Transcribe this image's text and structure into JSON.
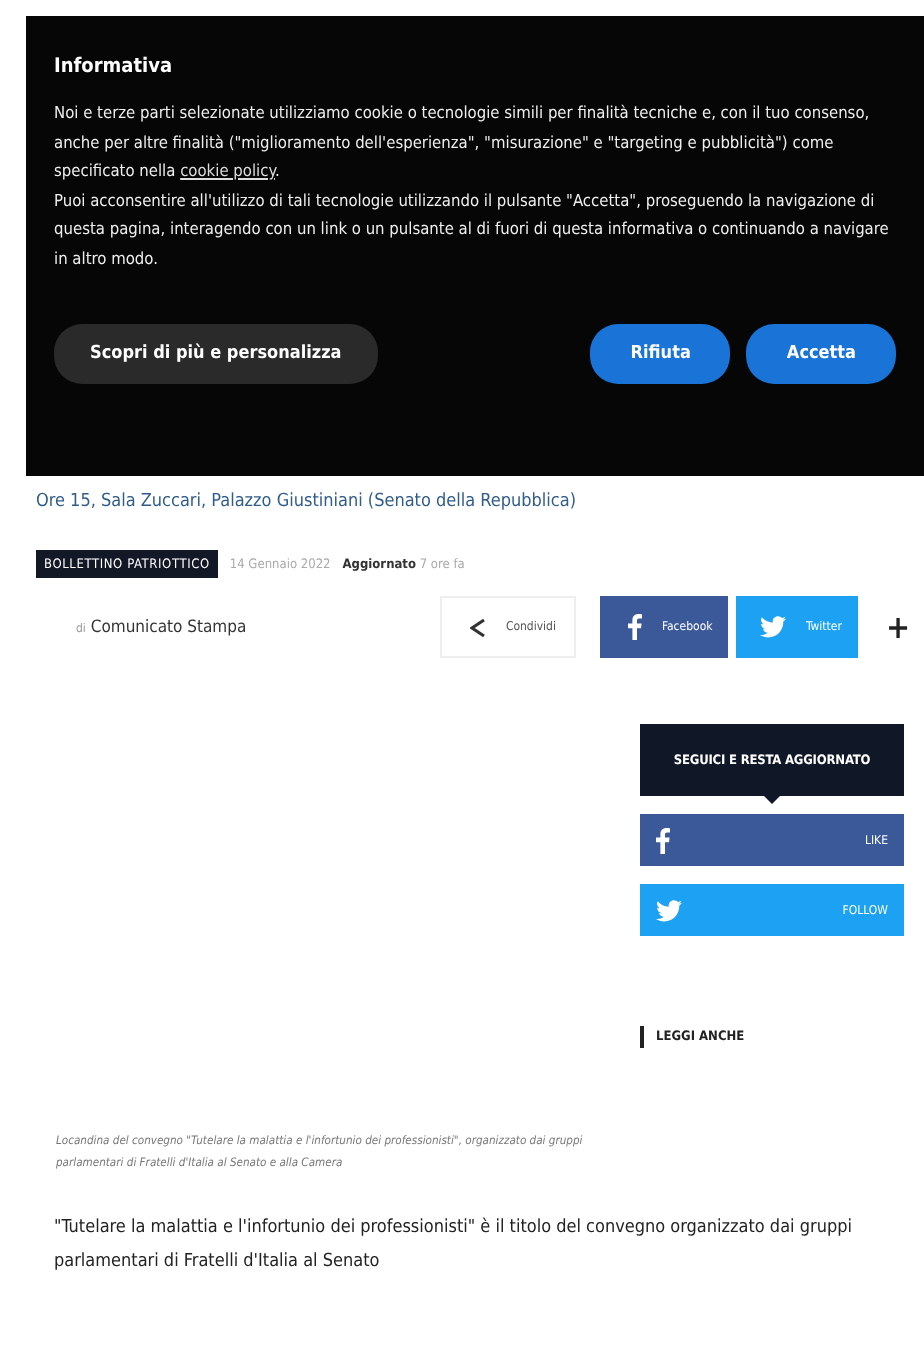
{
  "cookie_banner": {
    "title": "Informativa",
    "paragraphs": [
      "Noi e terze parti selezionate utilizziamo cookie o tecnologie simili per finalità tecniche e, con il tuo consenso, anche per altre finalità (\"miglioramento dell'esperienza\", \"misurazione\" e \"targeting e pubblicità\") come specificato nella ",
      "Puoi acconsentire all'utilizzo di tali tecnologie utilizzando il pulsante \"Accetta\", proseguendo la navigazione di questa pagina, interagendo con un link o un pulsante al di fuori di questa informativa o continuando a navigare in altro modo."
    ],
    "link": "cookie policy",
    "link_suffix": ".",
    "buttons": [
      {
        "label": "Scopri di più e personalizza",
        "kind": "secondary"
      },
      {
        "label": "Rifiuta",
        "kind": "primary"
      },
      {
        "label": "Accetta",
        "kind": "primary"
      }
    ]
  },
  "article": {
    "subtitle": "Ore 15, Sala Zuccari, Palazzo Giustiniani (Senato della Repubblica)",
    "category": "BOLLETTINO PATRIOTTICO",
    "date": "14 Gennaio 2022",
    "updated_label": "Aggiornato",
    "updated": "7 ore fa",
    "author_prefix": "di",
    "author": "Comunicato Stampa",
    "caption": "Locandina del convegno \"Tutelare la malattia e l'infortunio dei professionisti\", organizzato dai gruppi parlamentari di Fratelli d'Italia al Senato e alla Camera",
    "body": "\"Tutelare la malattia e l'infortunio dei professionisti\" è il titolo del convegno organizzato dai gruppi parlamentari di Fratelli d'Italia al Senato"
  },
  "share": [
    {
      "kind": "share",
      "label": "Condividi"
    },
    {
      "kind": "facebook",
      "label": "Facebook"
    },
    {
      "kind": "twitter",
      "label": "Twitter"
    },
    {
      "kind": "more",
      "label": "+"
    }
  ],
  "sidebar": {
    "follow_title": "SEGUICI E RESTA AGGIORNATO",
    "follow": [
      {
        "kind": "facebook",
        "label": "LIKE"
      },
      {
        "kind": "twitter",
        "label": "FOLLOW"
      }
    ],
    "read_also": "LEGGI ANCHE"
  }
}
